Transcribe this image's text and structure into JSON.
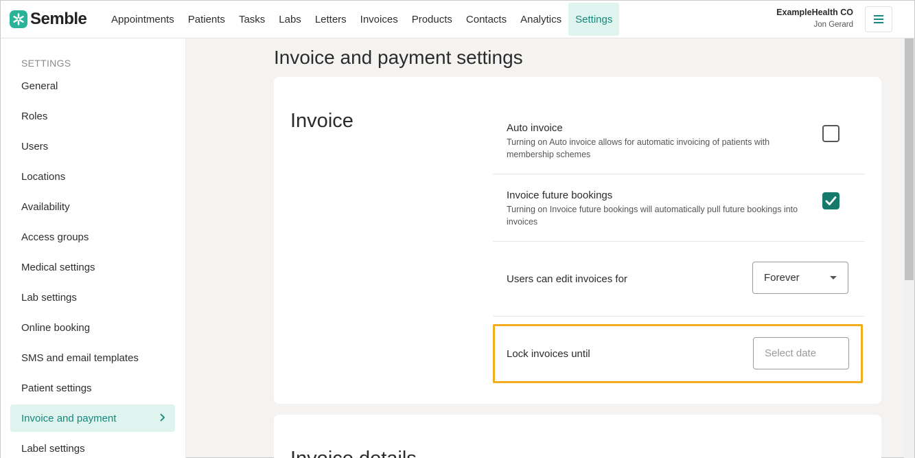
{
  "brand": {
    "name": "Semble",
    "accent": "#2bb39a"
  },
  "nav": {
    "items": [
      {
        "label": "Appointments"
      },
      {
        "label": "Patients"
      },
      {
        "label": "Tasks"
      },
      {
        "label": "Labs"
      },
      {
        "label": "Letters"
      },
      {
        "label": "Invoices"
      },
      {
        "label": "Products"
      },
      {
        "label": "Contacts"
      },
      {
        "label": "Analytics"
      },
      {
        "label": "Settings",
        "active": true
      }
    ]
  },
  "account": {
    "org": "ExampleHealth CO",
    "user": "Jon Gerard",
    "menu_icon": "hamburger-icon"
  },
  "sidebar": {
    "heading": "SETTINGS",
    "items": [
      {
        "label": "General"
      },
      {
        "label": "Roles"
      },
      {
        "label": "Users"
      },
      {
        "label": "Locations"
      },
      {
        "label": "Availability"
      },
      {
        "label": "Access groups"
      },
      {
        "label": "Medical settings"
      },
      {
        "label": "Lab settings"
      },
      {
        "label": "Online booking"
      },
      {
        "label": "SMS and email templates"
      },
      {
        "label": "Patient settings"
      },
      {
        "label": "Invoice and payment",
        "active": true
      },
      {
        "label": "Label settings"
      }
    ]
  },
  "page": {
    "title": "Invoice and payment settings"
  },
  "invoice_section": {
    "title": "Invoice",
    "auto_invoice": {
      "label": "Auto invoice",
      "description": "Turning on Auto invoice allows for automatic invoicing of patients with membership schemes",
      "checked": false
    },
    "future_bookings": {
      "label": "Invoice future bookings",
      "description": "Turning on Invoice future bookings will automatically pull future bookings into invoices",
      "checked": true
    },
    "edit_period": {
      "label": "Users can edit invoices for",
      "value": "Forever"
    },
    "lock_invoices": {
      "label": "Lock invoices until",
      "placeholder": "Select date"
    }
  },
  "invoice_details_section": {
    "title": "Invoice details"
  },
  "colors": {
    "highlight": "#f2ac1c",
    "active_bg": "#dff3ef",
    "active_text": "#16867a",
    "checkbox_checked": "#167a6b"
  }
}
